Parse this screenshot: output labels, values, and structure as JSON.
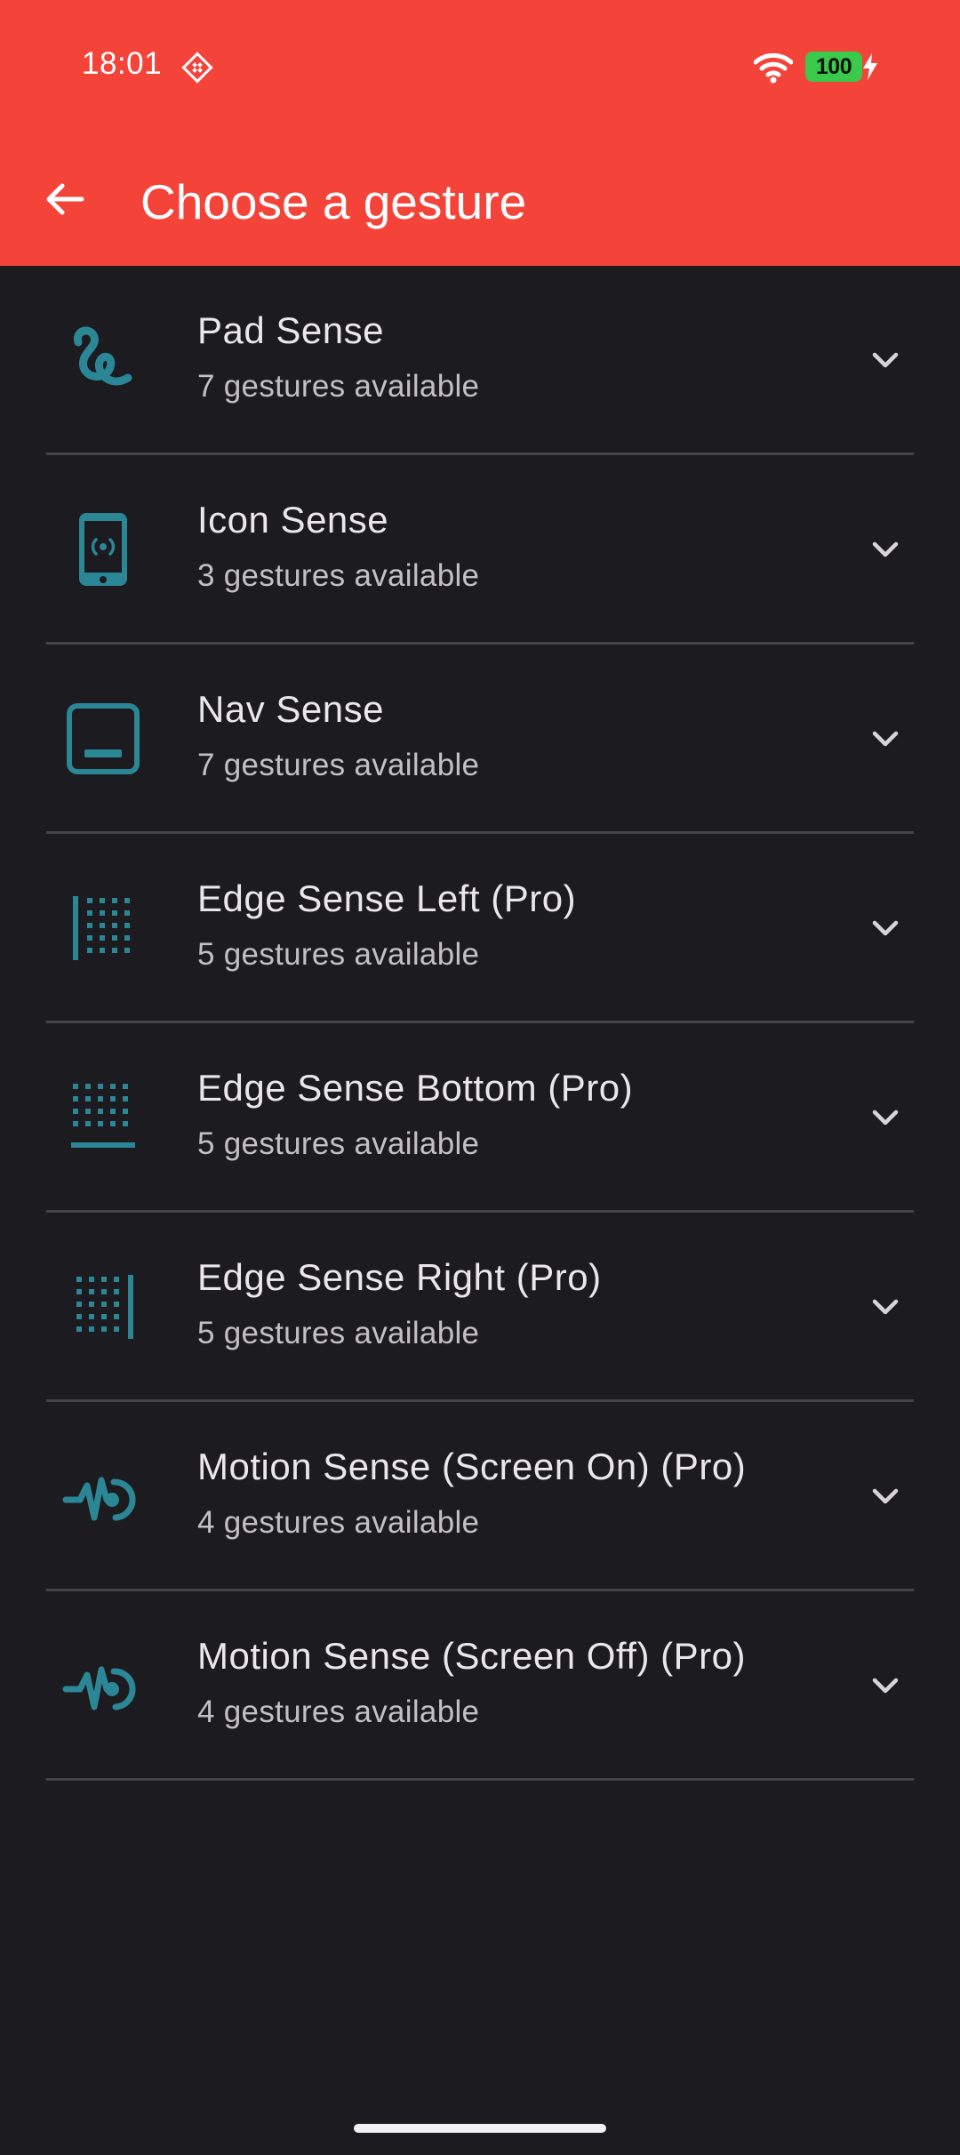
{
  "status_bar": {
    "time": "18:01",
    "battery_level": "100",
    "notification_icon": "diamond-grid-icon",
    "wifi_icon": "wifi-icon",
    "charging_icon": "bolt-icon"
  },
  "app_bar": {
    "title": "Choose a gesture",
    "back_icon": "arrow-back-icon",
    "background_color": "#f4443a"
  },
  "colors": {
    "background": "#1c1b20",
    "icon_accent": "#2b8696",
    "divider": "#45444a",
    "battery": "#3ac94a"
  },
  "gestures": [
    {
      "title": "Pad Sense",
      "subtitle": "7 gestures available",
      "icon": "squiggle-icon",
      "expand_icon": "chevron-down-icon"
    },
    {
      "title": "Icon Sense",
      "subtitle": "3 gestures available",
      "icon": "phone-signal-icon",
      "expand_icon": "chevron-down-icon"
    },
    {
      "title": "Nav Sense",
      "subtitle": "7 gestures available",
      "icon": "nav-bar-icon",
      "expand_icon": "chevron-down-icon"
    },
    {
      "title": "Edge Sense Left (Pro)",
      "subtitle": "5 gestures available",
      "icon": "edge-left-icon",
      "expand_icon": "chevron-down-icon"
    },
    {
      "title": "Edge Sense Bottom (Pro)",
      "subtitle": "5 gestures available",
      "icon": "edge-bottom-icon",
      "expand_icon": "chevron-down-icon"
    },
    {
      "title": "Edge Sense Right (Pro)",
      "subtitle": "5 gestures available",
      "icon": "edge-right-icon",
      "expand_icon": "chevron-down-icon"
    },
    {
      "title": "Motion Sense (Screen On) (Pro)",
      "subtitle": "4 gestures available",
      "icon": "motion-pulse-icon",
      "expand_icon": "chevron-down-icon"
    },
    {
      "title": "Motion Sense (Screen Off) (Pro)",
      "subtitle": "4 gestures available",
      "icon": "motion-pulse-icon",
      "expand_icon": "chevron-down-icon"
    }
  ]
}
